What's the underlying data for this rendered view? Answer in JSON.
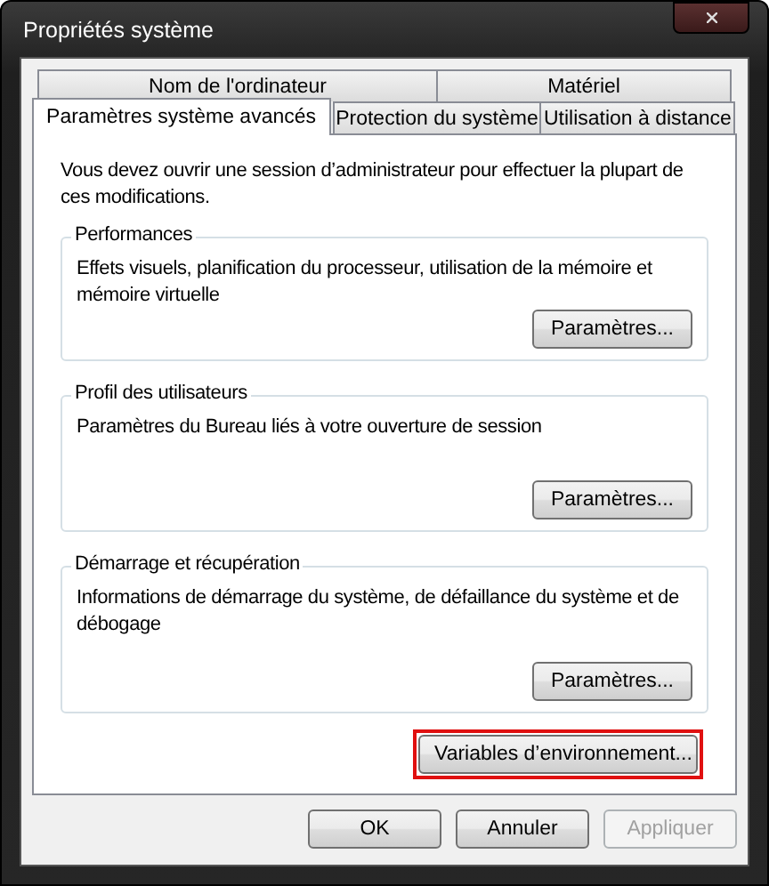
{
  "window": {
    "title": "Propriétés système"
  },
  "tab_rows": [
    {
      "tabs": [
        {
          "label": "Nom de l'ordinateur",
          "selected": false
        },
        {
          "label": "Matériel",
          "selected": false
        }
      ]
    },
    {
      "tabs": [
        {
          "label": "Paramètres système avancés",
          "selected": true
        },
        {
          "label": "Protection du système",
          "selected": false
        },
        {
          "label": "Utilisation à distance",
          "selected": false
        }
      ]
    }
  ],
  "notice": "Vous devez ouvrir une session d’administrateur pour effectuer la plupart de ces modifications.",
  "groups": [
    {
      "title": "Performances",
      "text": "Effets visuels, planification du processeur, utilisation de la mémoire et mémoire virtuelle",
      "button": "Paramètres..."
    },
    {
      "title": "Profil des utilisateurs",
      "text": "Paramètres du Bureau liés à votre ouverture de session",
      "button": "Paramètres..."
    },
    {
      "title": "Démarrage et récupération",
      "text": "Informations de démarrage du système, de défaillance du système et de débogage",
      "button": "Paramètres..."
    }
  ],
  "environment_button": {
    "label": "Variables d’environnement...",
    "highlighted": true
  },
  "buttons": [
    {
      "label": "OK",
      "disabled": false
    },
    {
      "label": "Annuler",
      "disabled": false
    },
    {
      "label": "Appliquer",
      "disabled": true
    }
  ]
}
